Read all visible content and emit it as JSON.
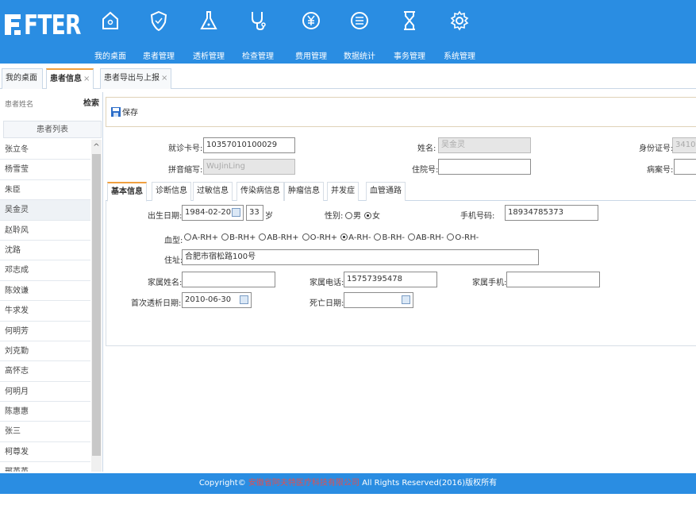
{
  "logo": {
    "text": "FTER"
  },
  "nav": [
    {
      "label": "我的桌面",
      "icon": "home-icon"
    },
    {
      "label": "患者管理",
      "icon": "shield-icon"
    },
    {
      "label": "透析管理",
      "icon": "flask-icon"
    },
    {
      "label": "检查管理",
      "icon": "stethoscope-icon"
    },
    {
      "label": "费用管理",
      "icon": "yuan-icon"
    },
    {
      "label": "数据统计",
      "icon": "list-icon"
    },
    {
      "label": "事务管理",
      "icon": "hourglass-icon"
    },
    {
      "label": "系统管理",
      "icon": "gear-icon"
    }
  ],
  "tabs": [
    {
      "label": "我的桌面",
      "close": ""
    },
    {
      "label": "患者信息",
      "close": "×"
    },
    {
      "label": "患者导出与上报",
      "close": "×"
    }
  ],
  "sidebar": {
    "search_placeholder": "患者姓名",
    "search_button": "检索",
    "list_title": "患者列表",
    "patients": [
      "张立冬",
      "杨雪莹",
      "朱臣",
      "吴金灵",
      "赵聆风",
      "沈路",
      "邓志成",
      "陈效谦",
      "牛求发",
      "何明芳",
      "刘克勤",
      "高怀志",
      "何明月",
      "陈惠惠",
      "张三",
      "柯尊发",
      "邢英英"
    ],
    "selected": "吴金灵"
  },
  "toolbar": {
    "save": "保存"
  },
  "header_form": {
    "card_label": "就诊卡号:",
    "card_value": "10357010100029",
    "name_label": "姓名:",
    "name_value": "吴金灵",
    "id_label": "身份证号:",
    "id_value": "3410",
    "pinyin_label": "拼音缩写:",
    "pinyin_value": "WuJinLing",
    "inpatient_label": "住院号:",
    "inpatient_value": "",
    "case_label": "病案号:",
    "case_value": ""
  },
  "subtabs": [
    "基本信息",
    "诊断信息",
    "过敏信息",
    "传染病信息",
    "肿瘤信息",
    "并发症",
    "血管通路"
  ],
  "basic": {
    "birth_label": "出生日期:",
    "birth_value": "1984-02-20",
    "age_value": "33",
    "age_unit": "岁",
    "sex_label": "性别:",
    "sex_options": [
      "男",
      "女"
    ],
    "sex_selected": "女",
    "phone_label": "手机号码:",
    "phone_value": "18934785373",
    "blood_label": "血型:",
    "blood_options": [
      "A-RH+",
      "B-RH+",
      "AB-RH+",
      "O-RH+",
      "A-RH-",
      "B-RH-",
      "AB-RH-",
      "O-RH-"
    ],
    "blood_selected": "A-RH-",
    "address_label": "住址:",
    "address_value": "合肥市宿松路100号",
    "family_name_label": "家属姓名:",
    "family_name_value": "",
    "family_phone_label": "家属电话:",
    "family_phone_value": "15757395478",
    "family_mobile_label": "家属手机:",
    "family_mobile_value": "",
    "first_dialysis_label": "首次透析日期:",
    "first_dialysis_value": "2010-06-30",
    "death_label": "死亡日期:",
    "death_value": ""
  },
  "footer": {
    "prefix": "Copyright©",
    "company": "安徽省阿夫特医疗科技有限公司",
    "suffix": "All Rights Reserved(2016)版权所有"
  },
  "colors": {
    "header": "#2a8de2",
    "tab_accent": "#f0a040",
    "company_text": "#e05050"
  }
}
